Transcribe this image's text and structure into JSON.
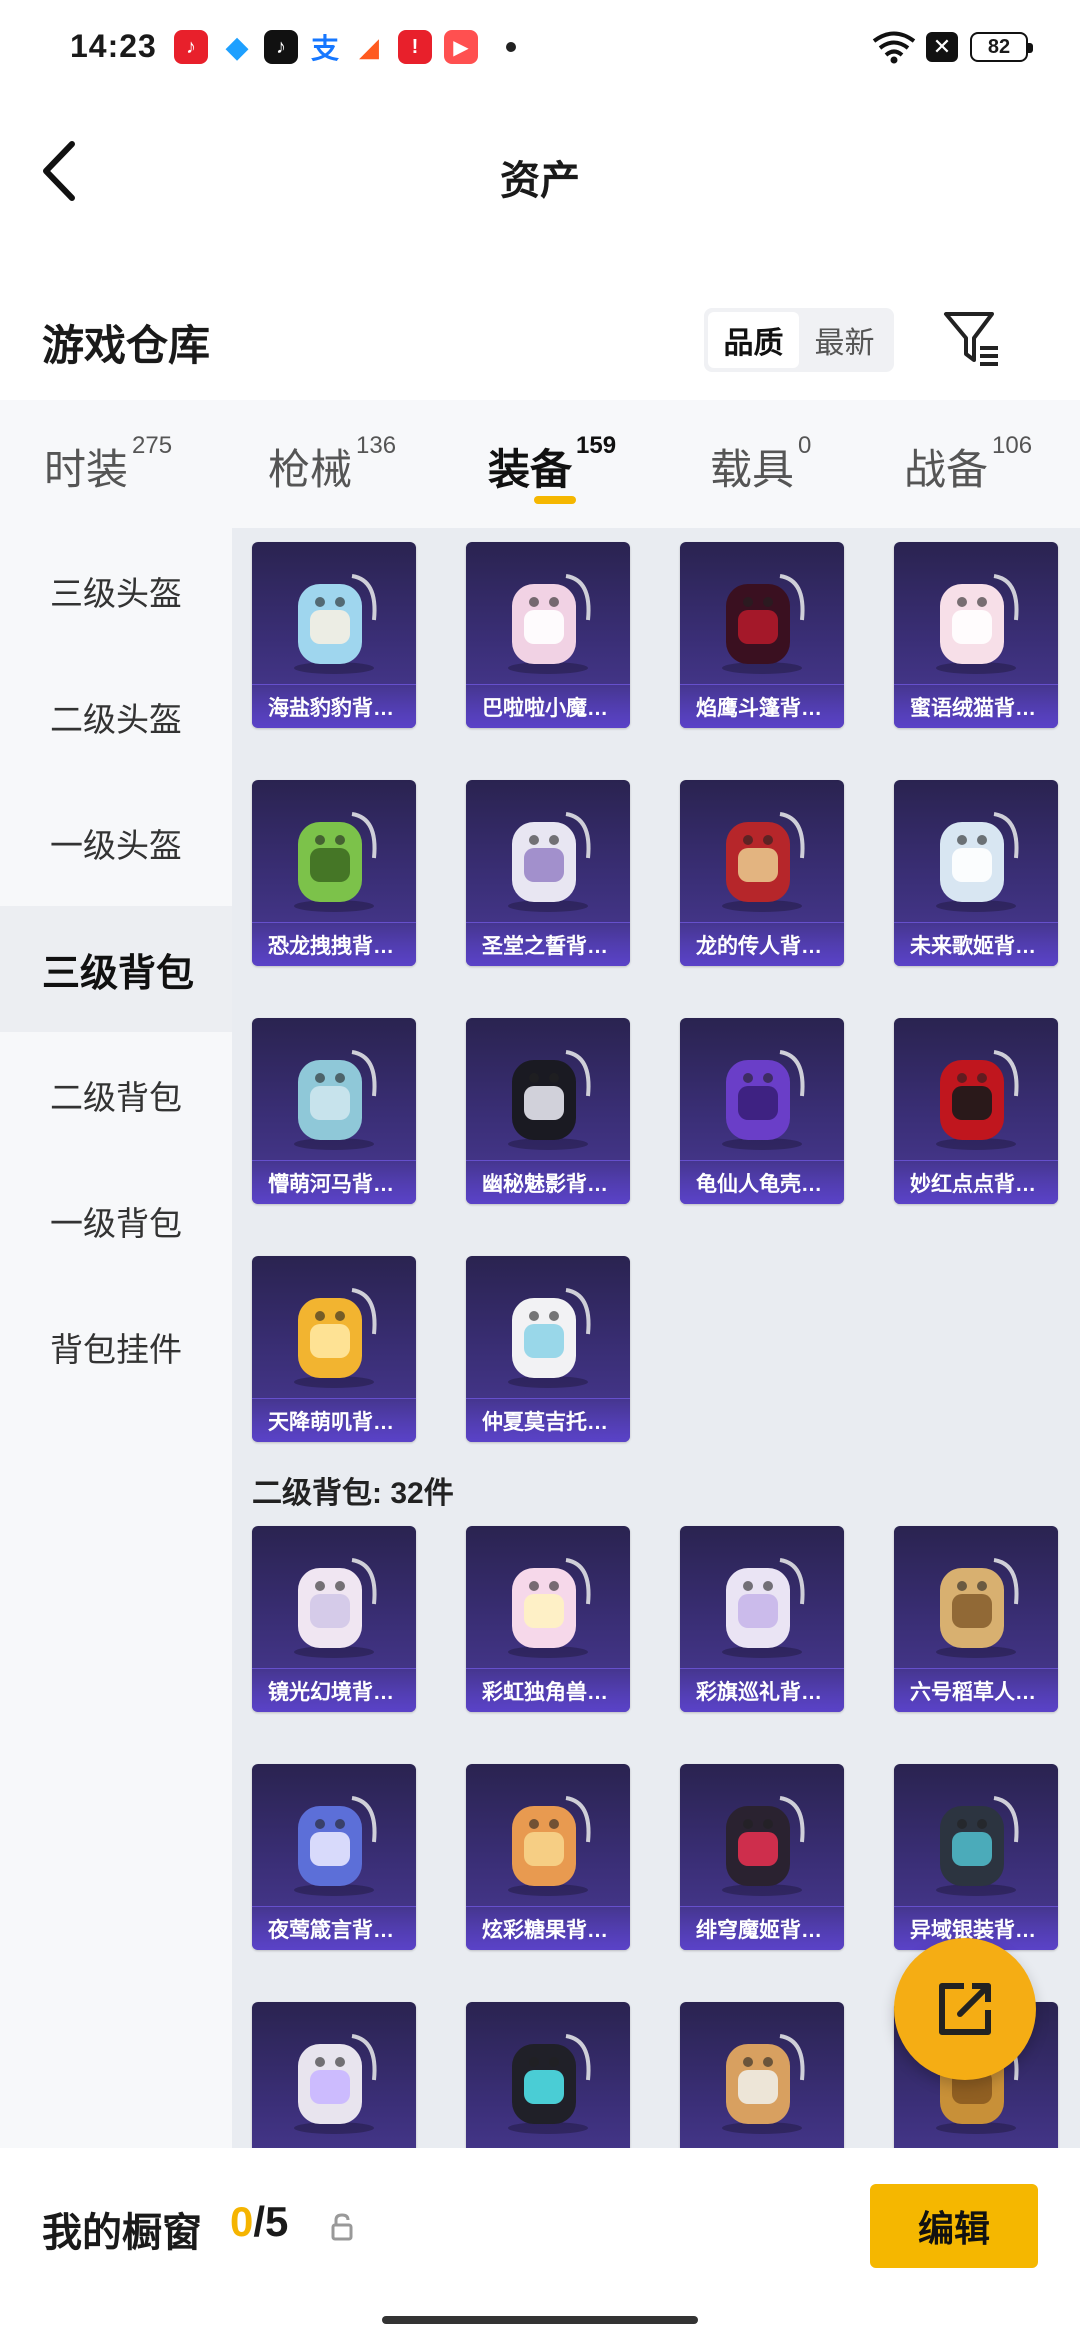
{
  "status_bar": {
    "time": "14:23",
    "battery": "82"
  },
  "header": {
    "title": "资产"
  },
  "section": {
    "title": "游戏仓库",
    "sort_quality": "品质",
    "sort_newest": "最新"
  },
  "tabs": [
    {
      "label": "时装",
      "count": "275"
    },
    {
      "label": "枪械",
      "count": "136"
    },
    {
      "label": "装备",
      "count": "159"
    },
    {
      "label": "载具",
      "count": "0"
    },
    {
      "label": "战备",
      "count": "106"
    }
  ],
  "sidebar": [
    {
      "label": "三级头盔"
    },
    {
      "label": "二级头盔"
    },
    {
      "label": "一级头盔"
    },
    {
      "label": "三级背包"
    },
    {
      "label": "二级背包"
    },
    {
      "label": "一级背包"
    },
    {
      "label": "背包挂件"
    }
  ],
  "groups": {
    "level3": {
      "items": [
        "海盐豹豹背…",
        "巴啦啦小魔…",
        "焰鹰斗篷背…",
        "蜜语绒猫背…",
        "恐龙拽拽背…",
        "圣堂之誓背…",
        "龙的传人背…",
        "未来歌姬背…",
        "懵萌河马背…",
        "幽秘魅影背…",
        "龟仙人龟壳…",
        "妙红点点背…",
        "天降萌叽背…",
        "仲夏莫吉托…"
      ]
    },
    "level2": {
      "title": "二级背包: 32件",
      "items": [
        "镜光幻境背…",
        "彩虹独角兽…",
        "彩旗巡礼背…",
        "六号稻草人…",
        "夜莺箴言背…",
        "炫彩糖果背…",
        "绯穹魔姬背…",
        "异域银装背…",
        "",
        "",
        "",
        ""
      ]
    }
  },
  "bottom": {
    "label": "我的橱窗",
    "current": "0",
    "total": "/5",
    "edit": "编辑"
  },
  "colors": {
    "accent": "#f5b700",
    "card_bg": "#3b2f78"
  }
}
